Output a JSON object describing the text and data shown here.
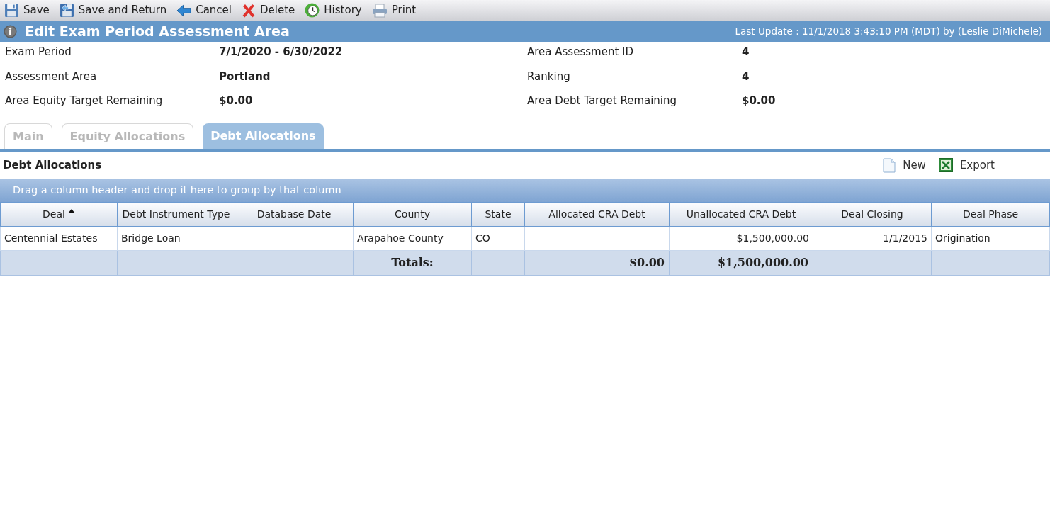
{
  "toolbar": [
    {
      "kind": "save",
      "label": "Save"
    },
    {
      "kind": "save_return",
      "label": "Save and Return"
    },
    {
      "kind": "cancel",
      "label": "Cancel"
    },
    {
      "kind": "delete",
      "label": "Delete"
    },
    {
      "kind": "history",
      "label": "History"
    },
    {
      "kind": "print",
      "label": "Print"
    }
  ],
  "title_bar": {
    "title": "Edit Exam Period Assessment Area",
    "last_update": "Last Update : 11/1/2018 3:43:10 PM (MDT) by (Leslie DiMichele)"
  },
  "fields": [
    {
      "label": "Exam Period",
      "value": "7/1/2020 - 6/30/2022"
    },
    {
      "label": "Area Assessment ID",
      "value": "4"
    },
    {
      "label": "Assessment Area",
      "value": "Portland"
    },
    {
      "label": "Ranking",
      "value": "4"
    },
    {
      "label": "Area Equity Target Remaining",
      "value": "$0.00"
    },
    {
      "label": "Area Debt Target Remaining",
      "value": "$0.00"
    }
  ],
  "tabs": [
    {
      "label": "Main",
      "selected": false
    },
    {
      "label": "Equity Allocations",
      "selected": false
    },
    {
      "label": "Debt Allocations",
      "selected": true
    }
  ],
  "section": {
    "title": "Debt Allocations",
    "actions": [
      {
        "kind": "new",
        "label": "New"
      },
      {
        "kind": "export",
        "label": "Export"
      }
    ]
  },
  "group_panel": {
    "text": "Drag a column header and drop it here to group by that column"
  },
  "table": {
    "columns": [
      {
        "label": "Deal",
        "kind": "text",
        "sorted": true
      },
      {
        "label": "Debt Instrument Type",
        "kind": "text",
        "sorted": false
      },
      {
        "label": "Database Date",
        "kind": "text",
        "sorted": false
      },
      {
        "label": "County",
        "kind": "text",
        "sorted": false,
        "total": "Totals:"
      },
      {
        "label": "State",
        "kind": "text",
        "sorted": false
      },
      {
        "label": "Allocated CRA Debt",
        "kind": "number",
        "sorted": false,
        "total": "$0.00"
      },
      {
        "label": "Unallocated CRA Debt",
        "kind": "number",
        "sorted": false,
        "total": "$1,500,000.00"
      },
      {
        "label": "Deal Closing",
        "kind": "number",
        "sorted": false
      },
      {
        "label": "Deal Phase",
        "kind": "text",
        "sorted": false
      }
    ],
    "rows": [
      {
        "cells": [
          "Centennial Estates",
          "Bridge Loan",
          null,
          "Arapahoe County",
          "CO",
          null,
          "$1,500,000.00",
          "1/1/2015",
          "Origination"
        ]
      }
    ]
  }
}
